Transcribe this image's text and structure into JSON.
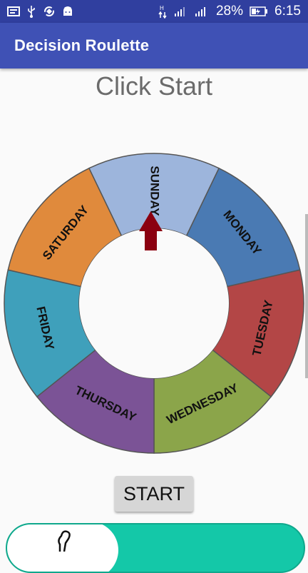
{
  "status_bar": {
    "battery_percent": "28%",
    "time": "6:15",
    "left_icons": [
      "gallery-icon",
      "usb-icon",
      "sync-icon",
      "android-icon"
    ],
    "right_icons": [
      "data-arrows-icon",
      "signal-icon",
      "signal-icon",
      "battery-icon"
    ]
  },
  "app_bar": {
    "title": "Decision Roulette"
  },
  "main": {
    "instruction": "Click Start",
    "wheel": {
      "segments": [
        {
          "label": "SUNDAY",
          "color": "#9db5dc"
        },
        {
          "label": "MONDAY",
          "color": "#4a7ab3"
        },
        {
          "label": "TUESDAY",
          "color": "#b34646"
        },
        {
          "label": "WEDNESDAY",
          "color": "#8ba54a"
        },
        {
          "label": "THURSDAY",
          "color": "#7b5396"
        },
        {
          "label": "FRIDAY",
          "color": "#3fa0bb"
        },
        {
          "label": "SATURDAY",
          "color": "#e08a3c"
        }
      ],
      "pointer_color": "#8b0010"
    },
    "start_button": "START"
  },
  "ad": {
    "color": "#14c8a8"
  }
}
